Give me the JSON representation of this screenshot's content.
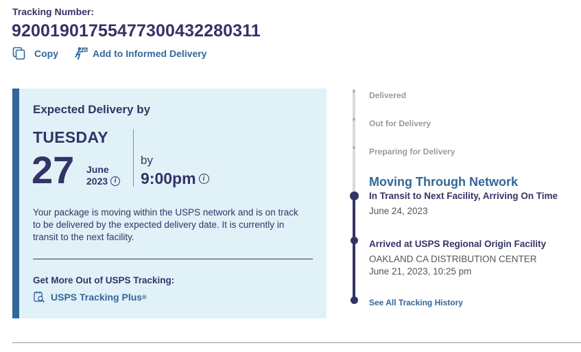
{
  "tracking": {
    "label": "Tracking Number:",
    "number": "9200190175547730043228031​1",
    "copy_label": "Copy",
    "informed_label": "Add to Informed Delivery"
  },
  "expected": {
    "title": "Expected Delivery by",
    "day": "TUESDAY",
    "date": "27",
    "month": "June",
    "year": "2023",
    "by": "by",
    "time": "9:00pm",
    "description": "Your package is moving within the USPS network and is on track to be delivered by the expected delivery date. It is currently in transit to the next facility.",
    "more_label": "Get More Out of USPS Tracking:",
    "plus_label": "USPS Tracking Plus",
    "plus_mark": "®"
  },
  "timeline": {
    "steps": [
      {
        "label": "Delivered"
      },
      {
        "label": "Out for Delivery"
      },
      {
        "label": "Preparing for Delivery"
      }
    ],
    "current": {
      "title": "Moving Through Network",
      "status": "In Transit to Next Facility, Arriving On Time",
      "date": "June 24, 2023"
    },
    "previous": {
      "status": "Arrived at USPS Regional Origin Facility",
      "location": "OAKLAND CA DISTRIBUTION CENTER",
      "date": "June 21, 2023, 10:25 pm"
    },
    "history_link": "See All Tracking History"
  },
  "colors": {
    "navy": "#333366",
    "link_blue": "#336699",
    "card_bg": "#e1f1f8",
    "muted_gray": "#999999"
  },
  "icons": {
    "copy": "copy-icon",
    "informed": "informed-delivery-icon",
    "info": "info-icon",
    "plus": "tracking-plus-icon"
  }
}
